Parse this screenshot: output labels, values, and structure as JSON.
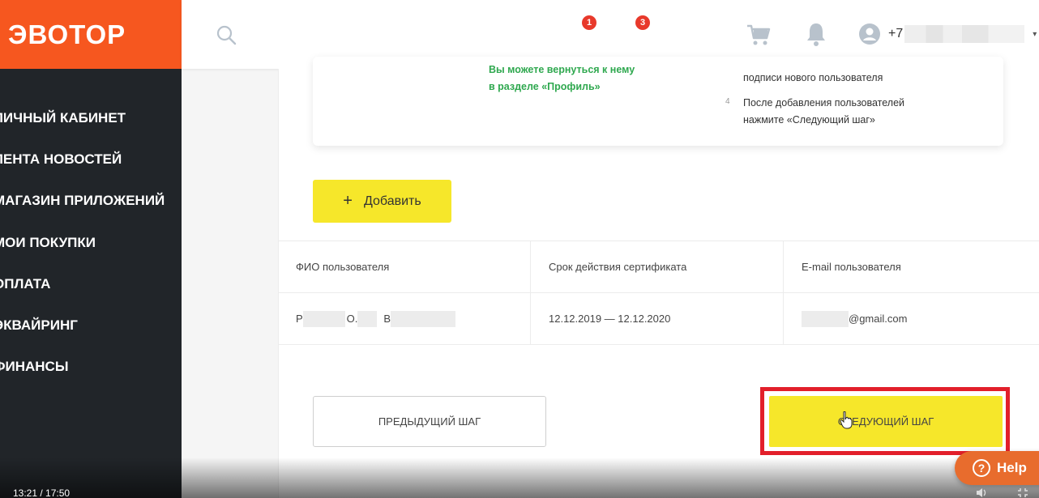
{
  "brand": {
    "logo_text": "ЭВОТОР",
    "accent": "#f6571f"
  },
  "sidebar": {
    "items": [
      {
        "label": "ЛИЧНЫЙ КАБИНЕТ"
      },
      {
        "label": "ЛЕНТА НОВОСТЕЙ"
      },
      {
        "label": "МАГАЗИН ПРИЛОЖЕНИЙ"
      },
      {
        "label": "МОИ ПОКУПКИ"
      },
      {
        "label": "ОПЛАТА"
      },
      {
        "label": "ЭКВАЙРИНГ"
      },
      {
        "label": "ФИНАНСЫ"
      }
    ]
  },
  "header": {
    "search_icon": "search-icon",
    "cart_badge": "1",
    "notifications_badge": "3",
    "user_phone_prefix": "+7",
    "caret": "▾"
  },
  "info": {
    "green_note_line1": "Вы можете вернуться к нему",
    "green_note_line2": "в разделе «Профиль»",
    "step3_tail": "подписи нового пользователя",
    "step4_number": "4",
    "step4_line1": "После добавления пользователей",
    "step4_line2": "нажмите «Следующий шаг»"
  },
  "add_button": {
    "icon": "+",
    "label": "Добавить"
  },
  "table": {
    "headers": [
      "ФИО пользователя",
      "Срок действия сертификата",
      "E-mail пользователя"
    ],
    "rows": [
      {
        "name_visible_1": "Р",
        "name_visible_2": "О.",
        "name_visible_3": "В",
        "validity": "12.12.2019 — 12.12.2020",
        "email_suffix": "@gmail.com"
      }
    ]
  },
  "nav_buttons": {
    "prev_label": "ПРЕДЫДУЩИЙ ШАГ",
    "next_label": "СЛЕДУЮЩИЙ ШАГ"
  },
  "video": {
    "time": "13:21 / 17:50"
  },
  "help": {
    "label": "Help",
    "icon": "?"
  },
  "colors": {
    "yellow": "#f6e72a",
    "highlight": "#e21f2a",
    "green": "#2fa84f",
    "badge": "#e8392b",
    "sidebar": "#212529",
    "help": "#e86c2d"
  }
}
